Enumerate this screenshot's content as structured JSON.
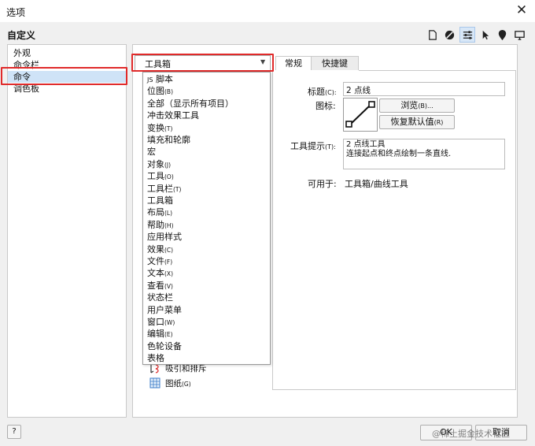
{
  "window": {
    "title": "选项",
    "close_symbol": "✕"
  },
  "header": {
    "section_title": "自定义",
    "toolbar_icons": [
      "page-icon",
      "color-wheel-icon",
      "sliders-icon",
      "pointer-icon",
      "location-pin-icon",
      "monitor-icon"
    ]
  },
  "nav": {
    "items": [
      {
        "label": "外观",
        "selected": false
      },
      {
        "label": "命令栏",
        "selected": false
      },
      {
        "label": "命令",
        "selected": true
      },
      {
        "label": "调色板",
        "selected": false
      }
    ]
  },
  "combo": {
    "value": "工具箱"
  },
  "dropdown": {
    "items": [
      {
        "prefix": "JS",
        "label": "脚本",
        "accel": ""
      },
      {
        "prefix": "",
        "label": "位图",
        "accel": "(B)"
      },
      {
        "prefix": "",
        "label": "全部（显示所有项目）",
        "accel": ""
      },
      {
        "prefix": "",
        "label": "冲击效果工具",
        "accel": ""
      },
      {
        "prefix": "",
        "label": "变换",
        "accel": "(T)"
      },
      {
        "prefix": "",
        "label": "填充和轮廓",
        "accel": ""
      },
      {
        "prefix": "",
        "label": "宏",
        "accel": ""
      },
      {
        "prefix": "",
        "label": "对象",
        "accel": "(J)"
      },
      {
        "prefix": "",
        "label": "工具",
        "accel": "(O)"
      },
      {
        "prefix": "",
        "label": "工具栏",
        "accel": "(T)"
      },
      {
        "prefix": "",
        "label": "工具箱",
        "accel": ""
      },
      {
        "prefix": "",
        "label": "布局",
        "accel": "(L)"
      },
      {
        "prefix": "",
        "label": "帮助",
        "accel": "(H)"
      },
      {
        "prefix": "",
        "label": "应用样式",
        "accel": ""
      },
      {
        "prefix": "",
        "label": "效果",
        "accel": "(C)"
      },
      {
        "prefix": "",
        "label": "文件",
        "accel": "(F)"
      },
      {
        "prefix": "",
        "label": "文本",
        "accel": "(X)"
      },
      {
        "prefix": "",
        "label": "查看",
        "accel": "(V)"
      },
      {
        "prefix": "",
        "label": "状态栏",
        "accel": ""
      },
      {
        "prefix": "",
        "label": "用户菜单",
        "accel": ""
      },
      {
        "prefix": "",
        "label": "窗口",
        "accel": "(W)"
      },
      {
        "prefix": "",
        "label": "编辑",
        "accel": "(E)"
      },
      {
        "prefix": "",
        "label": "色轮设备",
        "accel": ""
      },
      {
        "prefix": "",
        "label": "表格",
        "accel": ""
      }
    ]
  },
  "tree": {
    "items": [
      {
        "label": "吸引和排斥",
        "accel": "",
        "icon": "attract-repel-icon"
      },
      {
        "label": "图纸",
        "accel": "(G)",
        "icon": "graph-paper-icon"
      }
    ]
  },
  "tabs": {
    "general": "常规",
    "shortcut": "快捷键"
  },
  "general": {
    "title_label": "标题",
    "title_accel": "(C):",
    "title_value": "2 点线",
    "icon_label": "图标:",
    "browse_label": "浏览",
    "browse_accel": "(B)...",
    "restore_label": "恢复默认值",
    "restore_accel": "(R)",
    "tooltip_label": "工具提示",
    "tooltip_accel": "(T):",
    "tooltip_line1": "2 点线工具",
    "tooltip_line2": "连接起点和终点绘制一条直线.",
    "available_label": "可用于:",
    "available_value": "工具箱/曲线工具"
  },
  "footer": {
    "help": "?",
    "ok": "OK",
    "cancel": "取消",
    "watermark": "@稀土掘金技术社区"
  },
  "colors": {
    "highlight": "#e02a2a",
    "selection": "#cfe3f7"
  }
}
